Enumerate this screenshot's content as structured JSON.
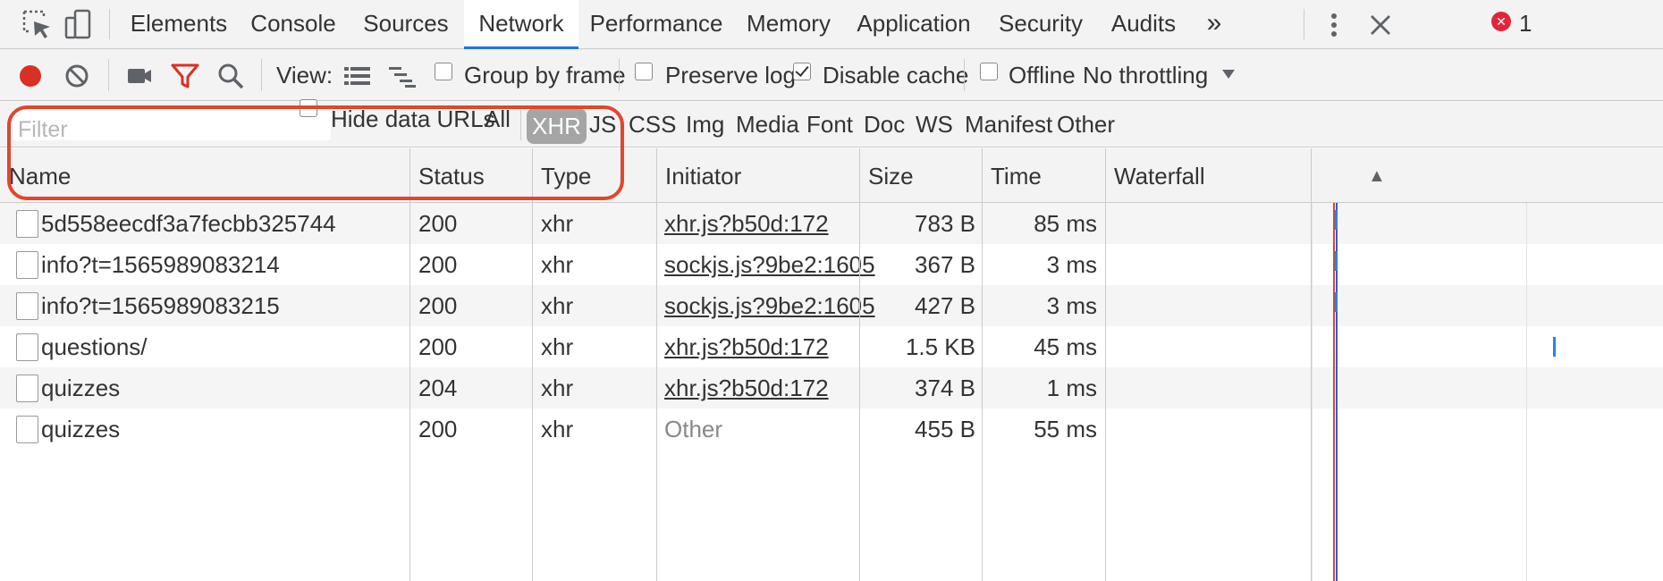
{
  "tabbar": {
    "tabs": [
      {
        "label": "Elements"
      },
      {
        "label": "Console"
      },
      {
        "label": "Sources"
      },
      {
        "label": "Network",
        "active": true
      },
      {
        "label": "Performance"
      },
      {
        "label": "Memory"
      },
      {
        "label": "Application"
      },
      {
        "label": "Security"
      },
      {
        "label": "Audits"
      }
    ],
    "overflow_label": "»",
    "error_badge_symbol": "✕",
    "error_count": "1",
    "icons": [
      "inspect-element-icon",
      "device-toolbar-icon",
      "overflow-chevron-icon",
      "error-icon",
      "more-vert-icon",
      "close-icon"
    ]
  },
  "toolbar": {
    "view_label": "View:",
    "group_by_frame": {
      "label": "Group by frame",
      "checked": false
    },
    "preserve_log": {
      "label": "Preserve log",
      "checked": false
    },
    "disable_cache": {
      "label": "Disable cache",
      "checked": true
    },
    "offline": {
      "label": "Offline",
      "checked": false
    },
    "throttling": "No throttling",
    "icons": [
      "record-icon",
      "clear-icon",
      "screenshot-camera-icon",
      "filter-funnel-icon",
      "search-icon",
      "list-view-icon",
      "waterfall-view-icon",
      "dropdown-arrow-icon"
    ],
    "colors": {
      "record": "#d93025",
      "filter_active": "#d93025"
    }
  },
  "filterbar": {
    "filter_placeholder": "Filter",
    "hide_data_urls": {
      "label": "Hide data URLs",
      "checked": false
    },
    "types": [
      "All",
      "XHR",
      "JS",
      "CSS",
      "Img",
      "Media",
      "Font",
      "Doc",
      "WS",
      "Manifest",
      "Other"
    ],
    "active_type": "XHR"
  },
  "table": {
    "columns": [
      "Name",
      "Status",
      "Type",
      "Initiator",
      "Size",
      "Time",
      "Waterfall"
    ],
    "sort_indicator": "▲",
    "rows": [
      {
        "name": "5d558eecdf3a7fecbb325744",
        "status": "200",
        "type": "xhr",
        "initiator": "xhr.js?b50d:172",
        "initiator_link": true,
        "size": "783 B",
        "time": "85 ms"
      },
      {
        "name": "info?t=1565989083214",
        "status": "200",
        "type": "xhr",
        "initiator": "sockjs.js?9be2:1605",
        "initiator_link": true,
        "size": "367 B",
        "time": "3 ms"
      },
      {
        "name": "info?t=1565989083215",
        "status": "200",
        "type": "xhr",
        "initiator": "sockjs.js?9be2:1605",
        "initiator_link": true,
        "size": "427 B",
        "time": "3 ms"
      },
      {
        "name": "questions/",
        "status": "200",
        "type": "xhr",
        "initiator": "xhr.js?b50d:172",
        "initiator_link": true,
        "size": "1.5 KB",
        "time": "45 ms"
      },
      {
        "name": "quizzes",
        "status": "204",
        "type": "xhr",
        "initiator": "xhr.js?b50d:172",
        "initiator_link": true,
        "size": "374 B",
        "time": "1 ms"
      },
      {
        "name": "quizzes",
        "status": "200",
        "type": "xhr",
        "initiator": "Other",
        "initiator_link": false,
        "size": "455 B",
        "time": "55 ms"
      }
    ]
  },
  "annotation_color": "#e0462d"
}
